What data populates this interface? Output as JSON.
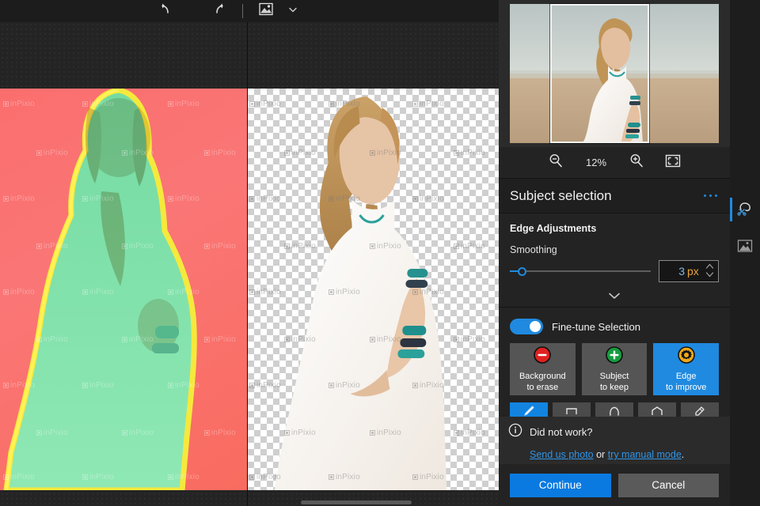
{
  "app": {
    "accent_color": "#1f8ae0",
    "panel_bg": "#232323",
    "canvas_bg": "#242424"
  },
  "toolbar": {
    "undo": {
      "label": "Undo",
      "icon": "undo-icon"
    },
    "redo": {
      "label": "Redo",
      "icon": "redo-icon"
    },
    "image": {
      "label": "Image",
      "icon": "image-icon"
    },
    "dropdown": {
      "label": "More",
      "icon": "chevron-down-icon"
    }
  },
  "canvas": {
    "left_pane": {
      "name": "mask-preview",
      "overlay_background_color": "#fa7070",
      "overlay_subject_color": "#6fe0a0",
      "overlay_edge_color": "#f5e93c",
      "watermark": "inPixio"
    },
    "right_pane": {
      "name": "result-preview",
      "transparency": "checkerboard",
      "watermark": "inPixio"
    }
  },
  "preview": {
    "crop_frame": true,
    "zoom": {
      "zoom_out_icon": "zoom-out-icon",
      "level": "12%",
      "zoom_in_icon": "zoom-in-icon",
      "fit_icon": "fit-to-screen-icon"
    }
  },
  "panel": {
    "title": "Subject selection",
    "menu_icon": "overflow-menu-icon",
    "edge_adjustments": {
      "heading": "Edge Adjustments",
      "smoothing": {
        "label": "Smoothing",
        "value": "3",
        "unit": "px",
        "percent": 4
      },
      "expand_icon": "chevron-down-icon"
    },
    "fine_tune": {
      "label": "Fine-tune Selection",
      "enabled": true
    },
    "modes": [
      {
        "name": "background-to-erase",
        "line1": "Background",
        "line2": "to erase",
        "icon": "minus-circle-icon",
        "icon_color": "#e02020",
        "active": false
      },
      {
        "name": "subject-to-keep",
        "line1": "Subject",
        "line2": "to keep",
        "icon": "plus-circle-icon",
        "icon_color": "#169c3e",
        "active": false
      },
      {
        "name": "edge-to-improve",
        "line1": "Edge",
        "line2": "to improve",
        "icon": "gear-icon",
        "icon_color": "#f0a818",
        "active": true
      }
    ],
    "tools": [
      {
        "name": "brush-tool",
        "icon": "brush-icon",
        "active": true
      },
      {
        "name": "rectangle-tool",
        "icon": "rectangle-icon",
        "active": false
      },
      {
        "name": "lasso-tool",
        "icon": "lasso-icon",
        "active": false
      },
      {
        "name": "polygon-tool",
        "icon": "polygon-icon",
        "active": false
      },
      {
        "name": "magic-wand-tool",
        "icon": "magic-wand-icon",
        "active": false
      }
    ]
  },
  "notice": {
    "icon": "info-icon",
    "question": "Did not work?",
    "link_send": "Send us photo",
    "conjunction": " or ",
    "link_manual": "try manual mode",
    "period": "."
  },
  "footer": {
    "continue_label": "Continue",
    "cancel_label": "Cancel"
  },
  "rail": [
    {
      "name": "cutout-tool",
      "icon": "cutout-icon",
      "active": true
    },
    {
      "name": "background-tool",
      "icon": "background-icon",
      "active": false
    }
  ]
}
